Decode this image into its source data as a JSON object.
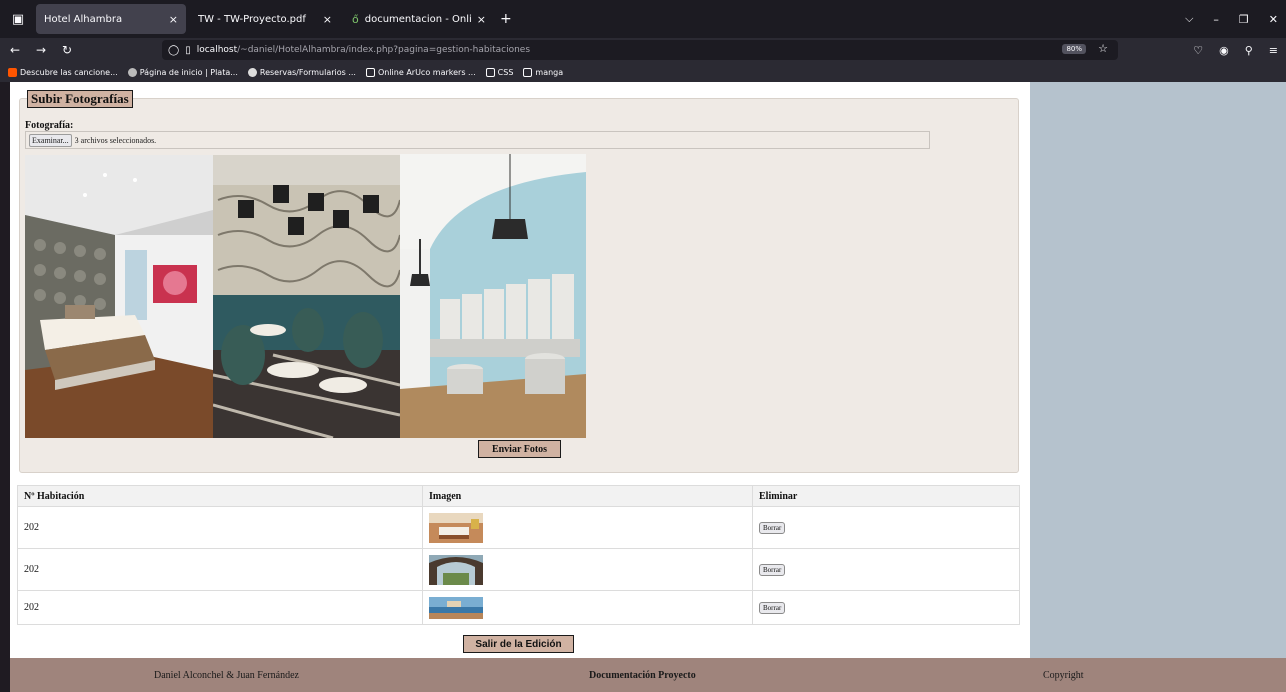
{
  "browser": {
    "tabs": [
      {
        "title": "Hotel Alhambra",
        "close": "×",
        "active": true
      },
      {
        "title": "TW - TW-Proyecto.pdf",
        "close": "×",
        "active": false
      },
      {
        "title": "documentacion - Online LaT",
        "close": "×",
        "active": false,
        "icon": "overleaf-icon"
      }
    ],
    "new_tab": "+",
    "url_host": "localhost",
    "url_rest": "/~daniel/HotelAlhambra/index.php?pagina=gestion-habitaciones",
    "zoom": "80%",
    "bookmarks": [
      {
        "label": "Descubre las cancione...",
        "icon": "soundcloud-icon",
        "color": "#ff5500"
      },
      {
        "label": "Página de inicio | Plata...",
        "icon": "moodle-icon",
        "color": "#bbbbbb"
      },
      {
        "label": "Reservas/Formularios ...",
        "icon": "globe-icon",
        "color": "#dddddd"
      },
      {
        "label": "Online ArUco markers ...",
        "icon": "aruco-icon",
        "color": "#ffffff"
      },
      {
        "label": "CSS",
        "icon": "folder-icon",
        "color": "#2b2a33"
      },
      {
        "label": "manga",
        "icon": "folder-icon",
        "color": "#2b2a33"
      }
    ]
  },
  "upload": {
    "legend": "Subir Fotografías",
    "field_label": "Fotografía:",
    "browse_button": "Examinar...",
    "files_status": "3 archivos seleccionados.",
    "submit_button": "Enviar Fotos"
  },
  "table": {
    "headers": [
      "Nº Habitación",
      "Imagen",
      "Eliminar"
    ],
    "rows": [
      {
        "room": "202",
        "action": "Borrar"
      },
      {
        "room": "202",
        "action": "Borrar"
      },
      {
        "room": "202",
        "action": "Borrar"
      }
    ]
  },
  "exit_button": "Salir de la Edición",
  "footer": {
    "authors": "Daniel Alconchel & Juan Fernández",
    "docs_link": "Documentación Proyecto",
    "copyright": "Copyright"
  },
  "colors": {
    "accent_button": "#d0b2a2",
    "sidebar": "#b5c2cd",
    "footer": "#9f847c",
    "upload_panel": "#efeae5"
  }
}
